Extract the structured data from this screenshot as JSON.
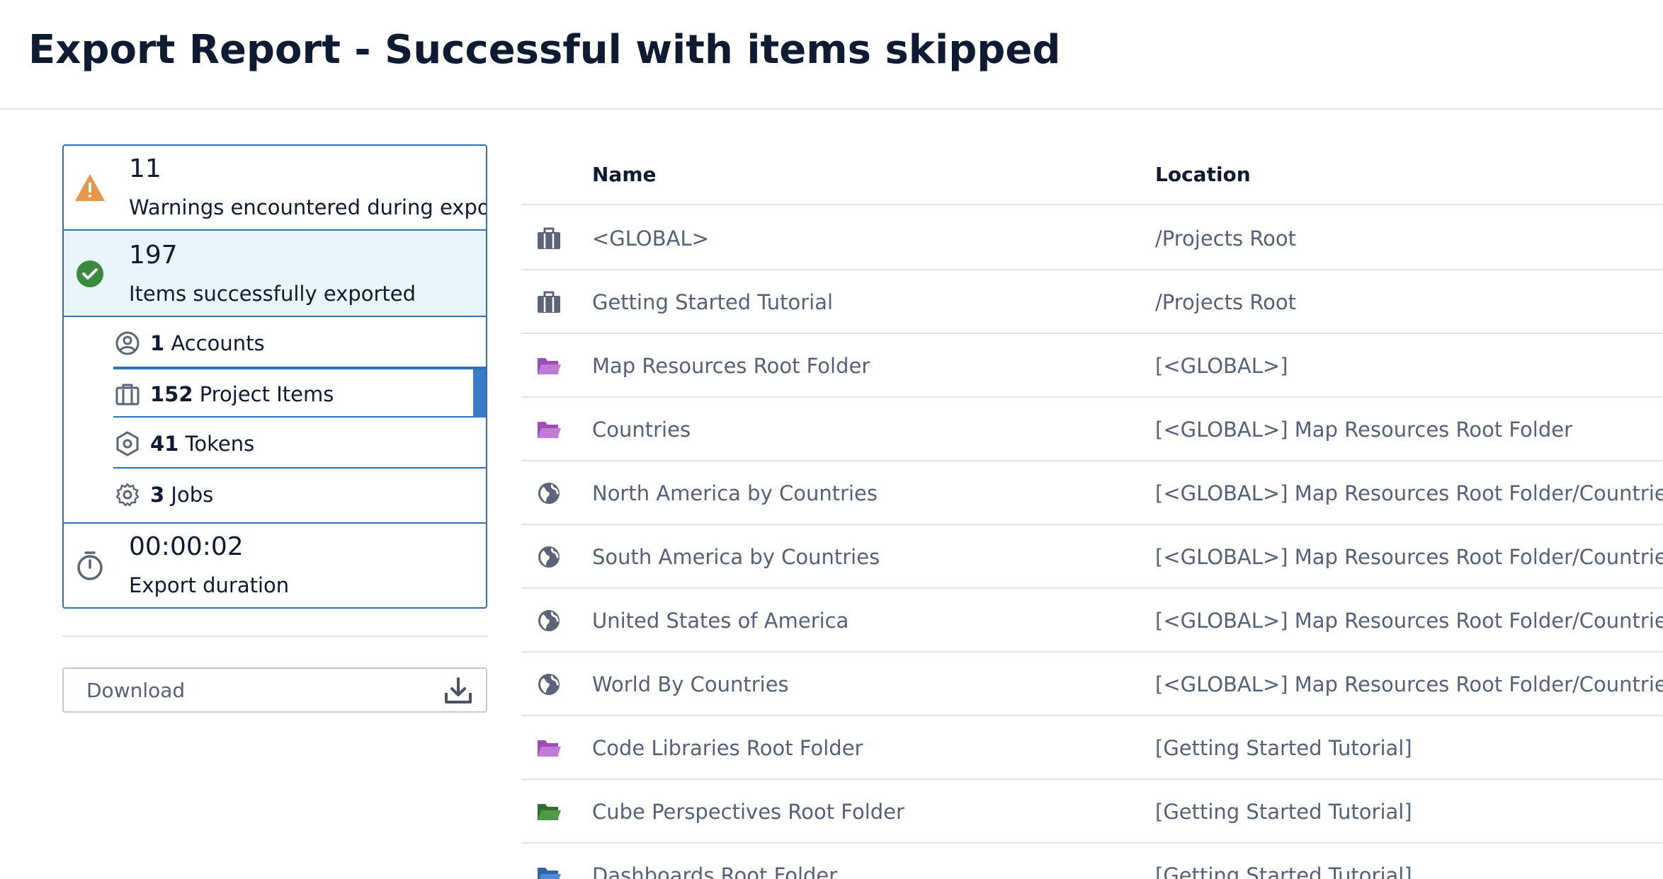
{
  "page": {
    "title": "Export Report - Successful with items skipped"
  },
  "summary": {
    "warnings": {
      "count": "11",
      "label": "Warnings encountered during export",
      "icon": "warning-icon",
      "color": "#e8954a"
    },
    "exported": {
      "count": "197",
      "label": "Items successfully exported",
      "icon": "check-circle-icon",
      "color": "#3a8a3f"
    },
    "breakdown": [
      {
        "count": "1",
        "label": "Accounts",
        "icon": "account-icon"
      },
      {
        "count": "152",
        "label": "Project Items",
        "icon": "project-icon",
        "selected": true
      },
      {
        "count": "41",
        "label": "Tokens",
        "icon": "token-icon"
      },
      {
        "count": "3",
        "label": "Jobs",
        "icon": "gear-icon"
      }
    ],
    "duration": {
      "value": "00:00:02",
      "label": "Export duration",
      "icon": "stopwatch-icon"
    }
  },
  "download": {
    "label": "Download",
    "icon": "download-icon"
  },
  "table": {
    "columns": {
      "name": "Name",
      "location": "Location"
    },
    "rows": [
      {
        "icon": "project-icon",
        "name": "<GLOBAL>",
        "location": "/Projects Root"
      },
      {
        "icon": "project-icon",
        "name": "Getting Started Tutorial",
        "location": "/Projects Root"
      },
      {
        "icon": "folder-purple-icon",
        "name": "Map Resources Root Folder",
        "location": "[<GLOBAL>]"
      },
      {
        "icon": "folder-purple-icon",
        "name": "Countries",
        "location": "[<GLOBAL>] Map Resources Root Folder"
      },
      {
        "icon": "globe-icon",
        "name": "North America by Countries",
        "location": "[<GLOBAL>] Map Resources Root Folder/Countries"
      },
      {
        "icon": "globe-icon",
        "name": "South America by Countries",
        "location": "[<GLOBAL>] Map Resources Root Folder/Countries"
      },
      {
        "icon": "globe-icon",
        "name": "United States of America",
        "location": "[<GLOBAL>] Map Resources Root Folder/Countries"
      },
      {
        "icon": "globe-icon",
        "name": "World By Countries",
        "location": "[<GLOBAL>] Map Resources Root Folder/Countries"
      },
      {
        "icon": "folder-purple-icon",
        "name": "Code Libraries Root Folder",
        "location": "[Getting Started Tutorial]"
      },
      {
        "icon": "folder-green-icon",
        "name": "Cube Perspectives Root Folder",
        "location": "[Getting Started Tutorial]"
      },
      {
        "icon": "folder-blue-icon",
        "name": "Dashboards Root Folder",
        "location": "[Getting Started Tutorial]"
      }
    ]
  },
  "colors": {
    "accent": "#2f6fb6",
    "selected_bar": "#3a7bc8",
    "exported_bg": "#e9f4fb",
    "folder_purple": "#9b4fb4",
    "folder_green": "#3d8a3a",
    "folder_blue": "#3a7bc8",
    "icon_gray": "#5c6577"
  }
}
